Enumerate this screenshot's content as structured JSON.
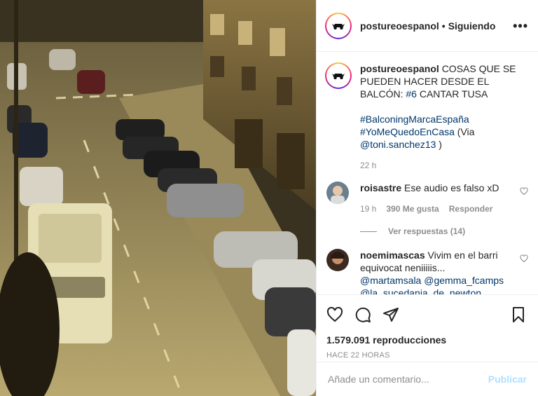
{
  "post": {
    "username": "postureoespanol",
    "separator": "•",
    "follow_status": "Siguiendo",
    "more_label": "•••",
    "caption": {
      "username": "postureoespanol",
      "text_1": "COSAS QUE SE PUEDEN HACER DESDE EL BALCÓN: ",
      "hashtag_number": "#6",
      "text_2": " CANTAR TUSA",
      "hashtag_1": "#BalconingMarcaEspaña",
      "hashtag_2": "#YoMeQuedoEnCasa",
      "via_open": " (Via ",
      "mention": "@toni.sanchez13",
      "via_close": " )",
      "time": "22 h"
    },
    "comments": [
      {
        "username": "roisastre",
        "text": "Ese audio es falso xD",
        "time": "19 h",
        "likes": "390 Me gusta",
        "reply_label": "Responder",
        "view_replies": "Ver respuestas (14)"
      },
      {
        "username": "noemimascas",
        "text": "Vivim en el barri equivocat neniiiiis...",
        "mention_1": "@martamsala",
        "mention_2": "@gemma_fcamps",
        "mention_3": "@la_sucedania_de_newton"
      }
    ],
    "views": "1.579.091 reproducciones",
    "posted": "HACE 22 HORAS",
    "comment_placeholder": "Añade un comentario...",
    "publish_label": "Publicar"
  },
  "icons": {
    "like": "heart-icon",
    "comment": "comment-icon",
    "share": "share-icon",
    "save": "bookmark-icon"
  },
  "colors": {
    "link": "#00376b",
    "muted": "#8e8e8e",
    "publish_disabled": "#b2dffc"
  }
}
